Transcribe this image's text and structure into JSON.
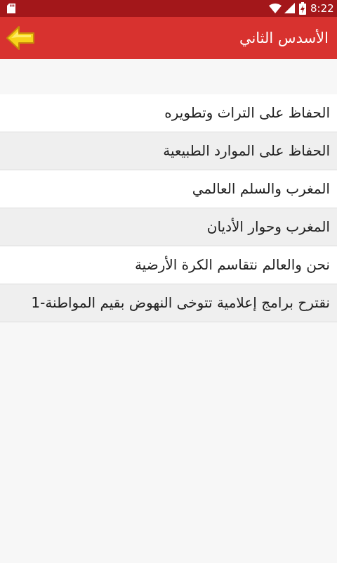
{
  "status_bar": {
    "time": "8:22",
    "icons": [
      "sd-card-icon",
      "wifi-icon",
      "signal-icon",
      "battery-charging-icon"
    ]
  },
  "app_bar": {
    "title": "الأسدس الثاني",
    "back_icon": "yellow-left-arrow-icon",
    "background_color": "#d8322f"
  },
  "lessons": [
    "الحفاظ على التراث وتطويره",
    "الحفاظ على الموارد الطبيعية",
    "المغرب والسلم العالمي",
    "المغرب وحوار الأديان",
    "نحن والعالم نتقاسم الكرة الأرضية",
    "نقترح برامج إعلامية تتوخى النهوض بقيم المواطنة-1"
  ]
}
